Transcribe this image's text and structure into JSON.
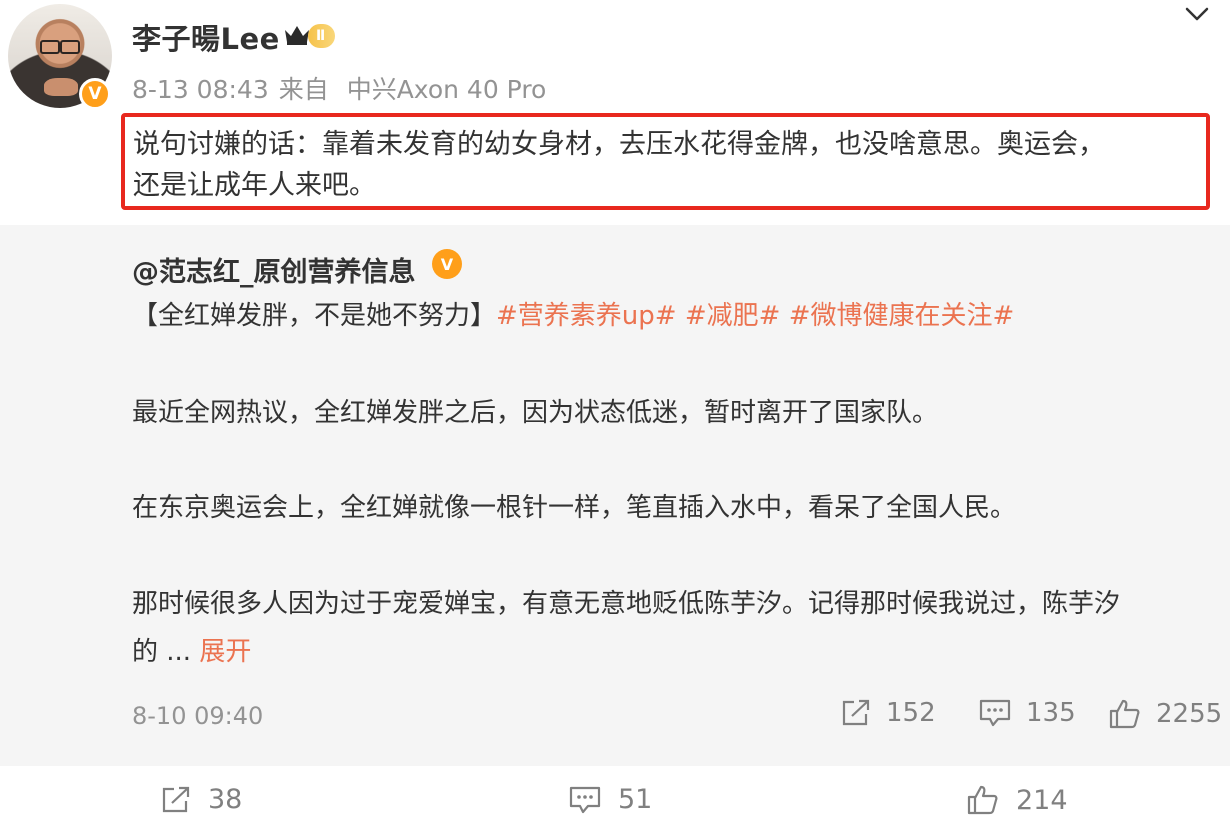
{
  "post": {
    "author": "李子暘Lee",
    "level_badge": "Ⅱ",
    "verified_mark": "V",
    "time": "8-13 08:43",
    "source_prefix": "来自",
    "source_device": "中兴Axon 40 Pro",
    "text_line1": "说句讨嫌的话：靠着未发育的幼女身材，去压水花得金牌，也没啥意思。奥运会，",
    "text_line2": "还是让成年人来吧。"
  },
  "repost": {
    "author": "@范志红_原创营养信息",
    "verified_mark": "V",
    "title_prefix": "【全红婵发胖，不是她不努力】",
    "topics": [
      "#营养素养up#",
      "#减肥#",
      "#微博健康在关注#"
    ],
    "paragraph1": "最近全网热议，全红婵发胖之后，因为状态低迷，暂时离开了国家队。",
    "paragraph2": "在东京奥运会上，全红婵就像一根针一样，笔直插入水中，看呆了全国人民。",
    "paragraph3_line1": "那时候很多人因为过于宠爱婵宝，有意无意地贬低陈芋汐。记得那时候我说过，陈芋汐",
    "paragraph3_line2": "的 ...",
    "expand_label": "展开",
    "time": "8-10 09:40",
    "reposts": "152",
    "comments": "135",
    "likes": "2255"
  },
  "actions": {
    "reposts": "38",
    "comments": "51",
    "likes": "214"
  },
  "colors": {
    "highlight_border": "#e8281e",
    "topic_link": "#eb7350",
    "meta_text": "#939393",
    "repost_bg": "#f5f5f5",
    "verified": "#ff9f1a"
  },
  "icons": [
    "avatar-photo",
    "verified-icon",
    "crown-icon",
    "chevron-down-icon",
    "repost-icon",
    "comment-icon",
    "like-icon"
  ]
}
